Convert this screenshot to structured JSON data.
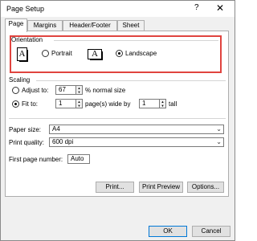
{
  "window": {
    "title": "Page Setup",
    "help_glyph": "?",
    "close_glyph": "✕"
  },
  "tabs": [
    {
      "label": "Page",
      "active": true
    },
    {
      "label": "Margins",
      "active": false
    },
    {
      "label": "Header/Footer",
      "active": false
    },
    {
      "label": "Sheet",
      "active": false
    }
  ],
  "orientation": {
    "group_label": "Orientation",
    "portrait_label": "Portrait",
    "landscape_label": "Landscape",
    "selected": "Landscape",
    "icon_letter": "A"
  },
  "scaling": {
    "group_label": "Scaling",
    "adjust_label": "Adjust to:",
    "adjust_value": "67",
    "adjust_suffix": "% normal size",
    "fit_label": "Fit to:",
    "fit_wide_value": "1",
    "fit_wide_suffix": "page(s) wide by",
    "fit_tall_value": "1",
    "fit_tall_suffix": "tall",
    "selected": "Fit to:"
  },
  "paper": {
    "label": "Paper size:",
    "value": "A4"
  },
  "quality": {
    "label": "Print quality:",
    "value": "600 dpi"
  },
  "first_page": {
    "label": "First page number:",
    "value": "Auto"
  },
  "buttons": {
    "print": "Print...",
    "preview": "Print Preview",
    "options": "Options...",
    "ok": "OK",
    "cancel": "Cancel"
  },
  "colors": {
    "highlight": "#e0443f",
    "accent": "#0078d7"
  }
}
